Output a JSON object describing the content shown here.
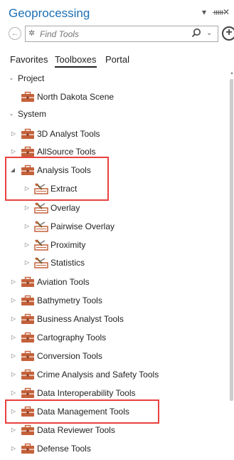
{
  "pane": {
    "title": "Geoprocessing",
    "controls": {
      "menu_glyph": "▾",
      "pin_glyph": "ᚔ",
      "close_glyph": "✕"
    }
  },
  "search": {
    "back_glyph": "←",
    "placeholder": "Find Tools",
    "value": "",
    "dropdown_glyph": "⌄",
    "add_glyph": "+"
  },
  "tabs": [
    {
      "label": "Favorites",
      "active": false
    },
    {
      "label": "Toolboxes",
      "active": true
    },
    {
      "label": "Portal",
      "active": false
    }
  ],
  "tree": [
    {
      "label": "Project",
      "caret": "⌄",
      "icon": "none"
    },
    {
      "label": "North Dakota Scene",
      "caret": "",
      "icon": "toolbox-icon"
    },
    {
      "label": "System",
      "caret": "⌄",
      "icon": "none"
    },
    {
      "label": "3D Analyst Tools",
      "caret": "▷",
      "icon": "toolbox-icon"
    },
    {
      "label": "AllSource Tools",
      "caret": "▷",
      "icon": "toolbox-icon"
    },
    {
      "label": "Analysis Tools",
      "caret": "◢",
      "icon": "toolbox-icon"
    },
    {
      "label": "Extract",
      "caret": "▷",
      "icon": "toolset-icon"
    },
    {
      "label": "Overlay",
      "caret": "▷",
      "icon": "toolset-icon"
    },
    {
      "label": "Pairwise Overlay",
      "caret": "▷",
      "icon": "toolset-icon"
    },
    {
      "label": "Proximity",
      "caret": "▷",
      "icon": "toolset-icon"
    },
    {
      "label": "Statistics",
      "caret": "▷",
      "icon": "toolset-icon"
    },
    {
      "label": "Aviation Tools",
      "caret": "▷",
      "icon": "toolbox-icon"
    },
    {
      "label": "Bathymetry Tools",
      "caret": "▷",
      "icon": "toolbox-icon"
    },
    {
      "label": "Business Analyst Tools",
      "caret": "▷",
      "icon": "toolbox-icon"
    },
    {
      "label": "Cartography Tools",
      "caret": "▷",
      "icon": "toolbox-icon"
    },
    {
      "label": "Conversion Tools",
      "caret": "▷",
      "icon": "toolbox-icon"
    },
    {
      "label": "Crime Analysis and Safety Tools",
      "caret": "▷",
      "icon": "toolbox-icon"
    },
    {
      "label": "Data Interoperability Tools",
      "caret": "▷",
      "icon": "toolbox-icon"
    },
    {
      "label": "Data Management Tools",
      "caret": "▷",
      "icon": "toolbox-icon"
    },
    {
      "label": "Data Reviewer Tools",
      "caret": "▷",
      "icon": "toolbox-icon"
    },
    {
      "label": "Defense Tools",
      "caret": "▷",
      "icon": "toolbox-icon"
    }
  ],
  "colors": {
    "title": "#1c6fb4",
    "toolbox": "#c4613a",
    "highlight": "#e8413f"
  }
}
